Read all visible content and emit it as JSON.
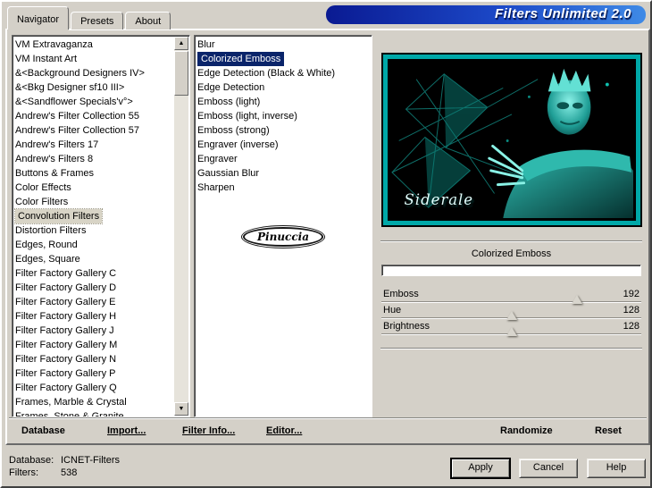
{
  "window": {
    "title": "Filters Unlimited 2.0"
  },
  "tabs": [
    {
      "label": "Navigator",
      "active": true
    },
    {
      "label": "Presets",
      "active": false
    },
    {
      "label": "About",
      "active": false
    }
  ],
  "navigator": {
    "categories": [
      "VM Extravaganza",
      "VM Instant Art",
      "&<Background Designers IV>",
      "&<Bkg Designer sf10 III>",
      "&<Sandflower Specials'v°>",
      "Andrew's Filter Collection 55",
      "Andrew's Filter Collection 57",
      "Andrew's Filters 17",
      "Andrew's Filters 8",
      "Buttons & Frames",
      "Color Effects",
      "Color Filters",
      "Convolution Filters",
      "Distortion Filters",
      "Edges, Round",
      "Edges, Square",
      "Filter Factory Gallery C",
      "Filter Factory Gallery D",
      "Filter Factory Gallery E",
      "Filter Factory Gallery H",
      "Filter Factory Gallery J",
      "Filter Factory Gallery M",
      "Filter Factory Gallery N",
      "Filter Factory Gallery P",
      "Filter Factory Gallery Q",
      "Frames, Marble & Crystal",
      "Frames, Stone & Granite"
    ],
    "selected_index": 12
  },
  "filters": {
    "items": [
      "Blur",
      "Colorized Emboss",
      "Edge Detection (Black & White)",
      "Edge Detection",
      "Emboss (light)",
      "Emboss (light, inverse)",
      "Emboss (strong)",
      "Engraver (inverse)",
      "Engraver",
      "Gaussian Blur",
      "Sharpen"
    ],
    "selected_index": 1
  },
  "watermark": {
    "label": "Pinuccia"
  },
  "preview": {
    "caption": "Siderale"
  },
  "controls": {
    "filter_title": "Colorized Emboss",
    "sliders": [
      {
        "label": "Emboss",
        "value": 192,
        "max": 255
      },
      {
        "label": "Hue",
        "value": 128,
        "max": 255
      },
      {
        "label": "Brightness",
        "value": 128,
        "max": 255
      }
    ]
  },
  "toolbar": {
    "database": "Database",
    "import": "Import...",
    "filter_info": "Filter Info...",
    "editor": "Editor...",
    "randomize": "Randomize",
    "reset": "Reset"
  },
  "status": {
    "database_label": "Database:",
    "database_value": "ICNET-Filters",
    "filters_label": "Filters:",
    "filters_value": "538"
  },
  "buttons": {
    "apply": "Apply",
    "cancel": "Cancel",
    "help": "Help"
  },
  "icons": {
    "scroll_up": "▲",
    "scroll_down": "▼"
  },
  "colors": {
    "selection": "#0a246a",
    "accent_teal": "#00a8a8",
    "banner_from": "#0a1a92",
    "banner_to": "#3f8ae6",
    "dialog_bg": "#d4d0c8"
  }
}
